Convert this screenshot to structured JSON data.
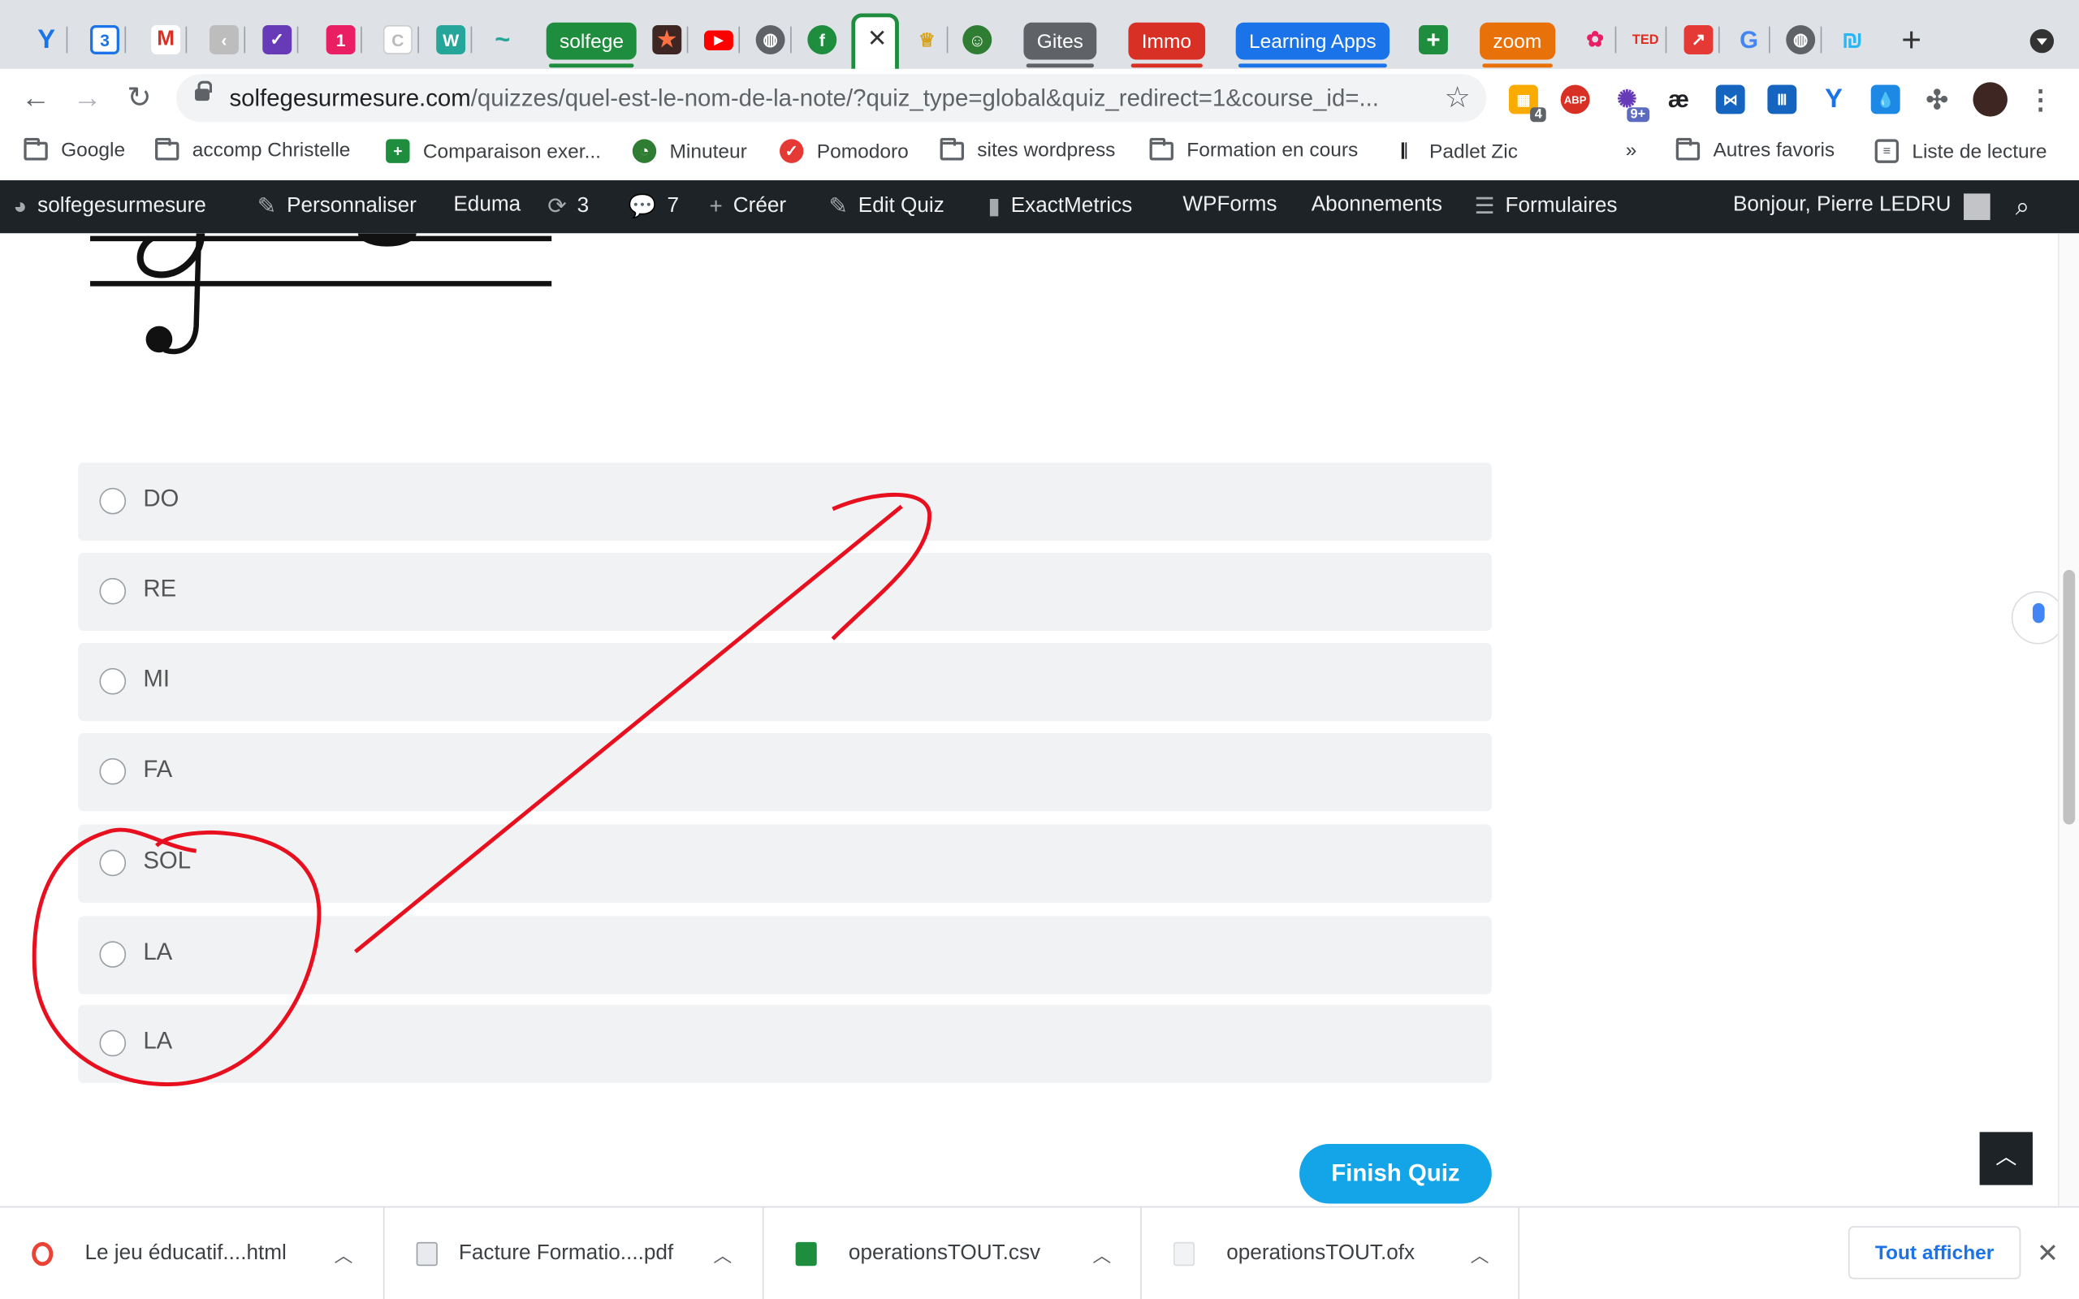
{
  "browser": {
    "tab_groups": [
      {
        "label": "solfege",
        "color": "#1e8e3e"
      },
      {
        "label": "Gites",
        "color": "#5f6368"
      },
      {
        "label": "Immo",
        "color": "#d93025"
      },
      {
        "label": "Learning Apps",
        "color": "#1a73e8"
      },
      {
        "label": "zoom",
        "color": "#e8710a"
      }
    ],
    "active_tab_icon": "close-icon",
    "tab_favicons": [
      {
        "icon": "y-icon",
        "glyph": "Y",
        "color": "#1a73e8"
      },
      {
        "icon": "calendar-icon",
        "glyph": "3",
        "color": "#1a73e8"
      },
      {
        "icon": "gmail-icon",
        "glyph": "M",
        "color": "#d93025"
      },
      {
        "icon": "app-icon",
        "glyph": "‹",
        "color": "#bdbdbd"
      },
      {
        "icon": "app-icon",
        "glyph": "✓",
        "color": "#673ab7"
      },
      {
        "icon": "one-icon",
        "glyph": "1",
        "color": "#e91e63"
      },
      {
        "icon": "blank-icon",
        "glyph": "C",
        "color": "#e0e0e0"
      },
      {
        "icon": "app-icon",
        "glyph": "W",
        "color": "#26a69a"
      },
      {
        "icon": "app-icon",
        "glyph": "~",
        "color": "#4db6ac"
      }
    ],
    "url_domain": "solfegesurmesure.com",
    "url_path": "/quizzes/quel-est-le-nom-de-la-note/?quiz_type=global&quiz_redirect=1&course_id=...",
    "extension_badges": {
      "first": "4",
      "second": "9+"
    },
    "bookmarks": [
      {
        "label": "Google",
        "type": "folder"
      },
      {
        "label": "accomp Christelle",
        "type": "folder"
      },
      {
        "label": "Comparaison exer...",
        "type": "sheet"
      },
      {
        "label": "Minuteur",
        "type": "app"
      },
      {
        "label": "Pomodoro",
        "type": "app"
      },
      {
        "label": "sites wordpress",
        "type": "folder"
      },
      {
        "label": "Formation en cours",
        "type": "folder"
      },
      {
        "label": "Padlet Zic",
        "type": "app"
      }
    ],
    "bookmarks_overflow": "»",
    "other_bookmarks": "Autres favoris",
    "reading_list": "Liste de lecture"
  },
  "admin_bar": {
    "site_name": "solfegesurmesure",
    "customize": "Personnaliser",
    "theme": "Eduma",
    "updates_count": "3",
    "comments_count": "7",
    "new": "Créer",
    "edit_quiz": "Edit Quiz",
    "exactmetrics": "ExactMetrics",
    "wpforms": "WPForms",
    "subscriptions": "Abonnements",
    "forms": "Formulaires",
    "greeting": "Bonjour, Pierre LEDRU"
  },
  "quiz": {
    "options": [
      "DO",
      "RE",
      "MI",
      "FA",
      "SOL",
      "LA",
      "LA"
    ],
    "finish_label": "Finish Quiz",
    "back_to_top_icon": "chevron-up-icon"
  },
  "downloads": {
    "items": [
      {
        "name": "Le jeu éducatif....html",
        "icon": "chrome-file-icon"
      },
      {
        "name": "Facture Formatio....pdf",
        "icon": "pdf-file-icon"
      },
      {
        "name": "operationsTOUT.csv",
        "icon": "excel-file-icon"
      },
      {
        "name": "operationsTOUT.ofx",
        "icon": "blank-file-icon"
      }
    ],
    "show_all": "Tout afficher"
  },
  "colors": {
    "annotation": "#e8101f",
    "finish_button": "#14a4e8",
    "admin_bar": "#1d2327",
    "option_bg": "#f0f2f4"
  }
}
